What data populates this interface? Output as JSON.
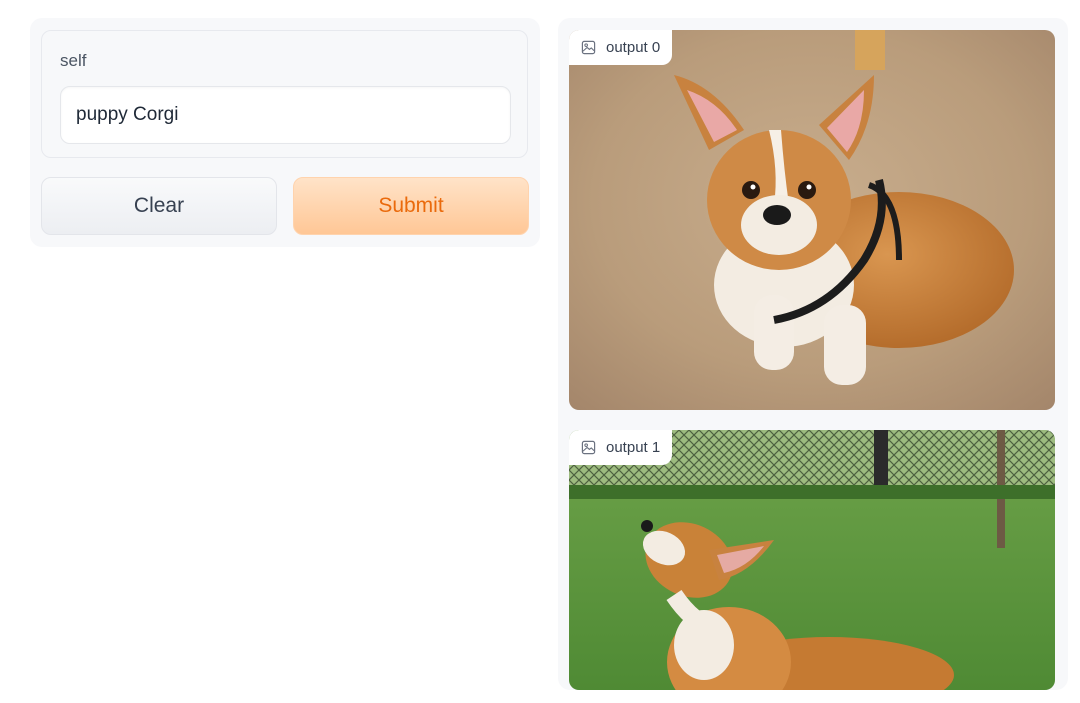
{
  "form": {
    "label": "self",
    "input_value": "puppy Corgi",
    "clear_label": "Clear",
    "submit_label": "Submit"
  },
  "outputs": [
    {
      "label": "output 0"
    },
    {
      "label": "output 1"
    }
  ],
  "colors": {
    "submit_text": "#ea6a0c",
    "submit_bg": "#ffc796",
    "panel_bg": "#f7f8fa"
  },
  "icons": {
    "output_tag": "image-icon"
  }
}
